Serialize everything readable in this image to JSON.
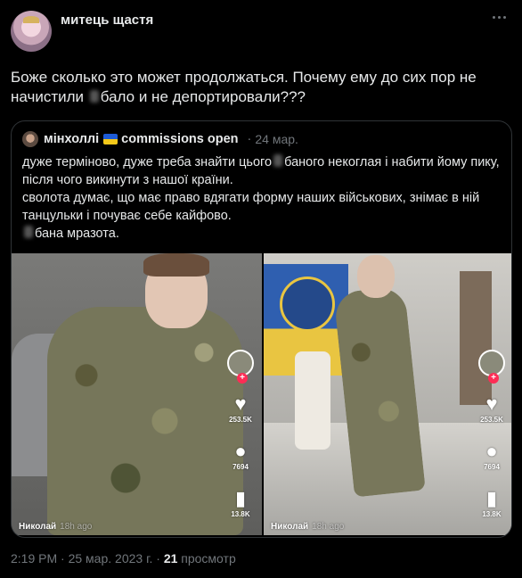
{
  "author": {
    "name": "митець щастя",
    "avatar_icon": "profile-avatar"
  },
  "post": {
    "text_part1": "Боже сколько это может продолжаться. Почему ему до сих пор не начистили ",
    "text_part2": "бало и не депортировали???"
  },
  "quote": {
    "author_name": "мінхоллі",
    "author_suffix": "commissions open",
    "flag_icon": "ukraine-flag-icon",
    "date_separator": "·",
    "date": "24 мар.",
    "line1_a": "дуже терміново, дуже треба знайти цього",
    "line1_b": "баного некоглая і набити йому пику, після чого викинути з нашої країни.",
    "line2": "сволота думає, що має право вдягати форму наших військових, знімає в ній танцульки і почуває себе кайфово.",
    "line3": "бана мразота."
  },
  "videos": [
    {
      "username": "Николай",
      "ago": "18h ago",
      "likes": "253.5K",
      "comments": "7694",
      "saves": "13.8K"
    },
    {
      "username": "Николай",
      "ago": "18h ago",
      "likes": "253.5K",
      "comments": "7694",
      "saves": "13.8K"
    }
  ],
  "meta": {
    "time": "2:19 PM",
    "sep1": "·",
    "date": "25 мар. 2023 г.",
    "sep2": "·",
    "views": "21",
    "views_label": "просмотр"
  },
  "colors": {
    "background": "#000000",
    "text": "#e7e9ea",
    "muted": "#71767b",
    "border": "#2f3336",
    "tiktok_red": "#fe2c55"
  }
}
